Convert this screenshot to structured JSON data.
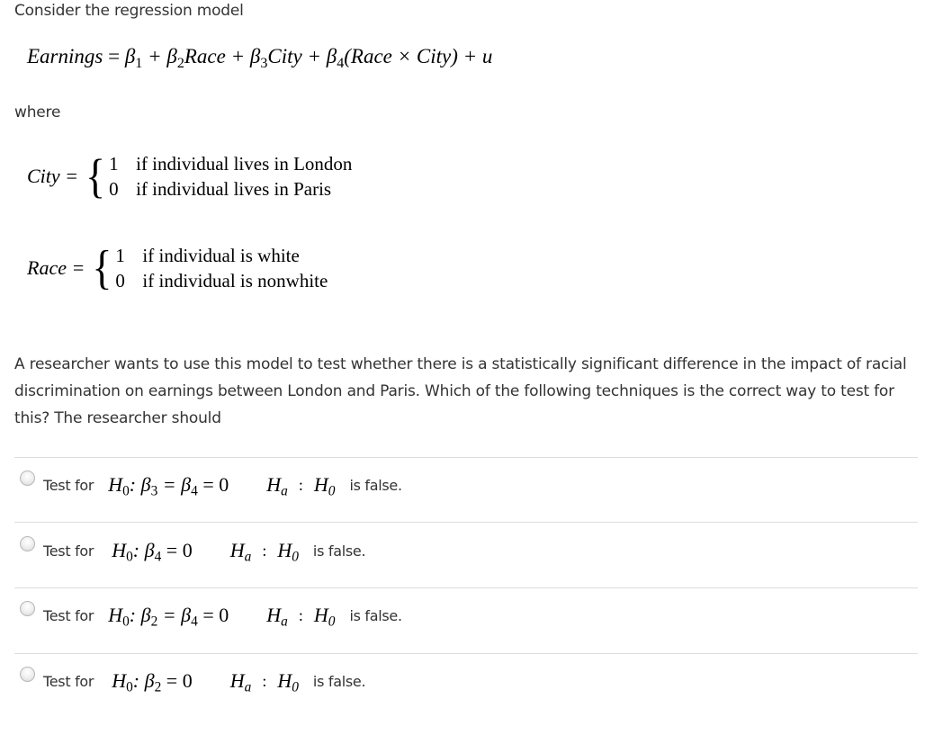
{
  "intro": "Consider the regression model",
  "equation": {
    "lhs": "Earnings",
    "eq": "=",
    "terms": [
      "β",
      "1",
      "+ β",
      "2",
      "Race + β",
      "3",
      "City + β",
      "4",
      "(Race × City) + u"
    ]
  },
  "where": "where",
  "city_def": {
    "lhs": "City =",
    "rows": [
      {
        "value": "1",
        "text": "if individual lives in London"
      },
      {
        "value": "0",
        "text": "if individual lives in Paris"
      }
    ]
  },
  "race_def": {
    "lhs": "Race =",
    "rows": [
      {
        "value": "1",
        "text": "if individual is white"
      },
      {
        "value": "0",
        "text": "if individual is nonwhite"
      }
    ]
  },
  "question": "A researcher wants to use this model to test whether there is a statistically significant difference in the impact of racial discrimination on earnings between London and Paris. Which of the following techniques is the correct way to test for this? The researcher should",
  "options": [
    {
      "prefix": "Test for",
      "h0_rest": ": β",
      "b1": "3",
      "mid": " = β",
      "b2": "4",
      "end": " = 0",
      "ha": "H",
      "ha_sub": "a",
      "colon": ":",
      "h0b_sub": "0",
      "suffix": "is false.",
      "selected": false
    },
    {
      "prefix": "Test for",
      "h0_rest": ": β",
      "b1": "4",
      "mid": "",
      "b2": "",
      "end": " = 0",
      "ha": "H",
      "ha_sub": "a",
      "colon": ":",
      "h0b_sub": "0",
      "suffix": "is false.",
      "selected": false
    },
    {
      "prefix": "Test for",
      "h0_rest": ": β",
      "b1": "2",
      "mid": " = β",
      "b2": "4",
      "end": " = 0",
      "ha": "H",
      "ha_sub": "a",
      "colon": ":",
      "h0b_sub": "0",
      "suffix": "is false.",
      "selected": false
    },
    {
      "prefix": "Test for",
      "h0_rest": ": β",
      "b1": "2",
      "mid": "",
      "b2": "",
      "end": " = 0",
      "ha": "H",
      "ha_sub": "a",
      "colon": ":",
      "h0b_sub": "0",
      "suffix": "is false.",
      "selected": false
    }
  ],
  "symbols": {
    "H": "H",
    "zero": "0"
  }
}
